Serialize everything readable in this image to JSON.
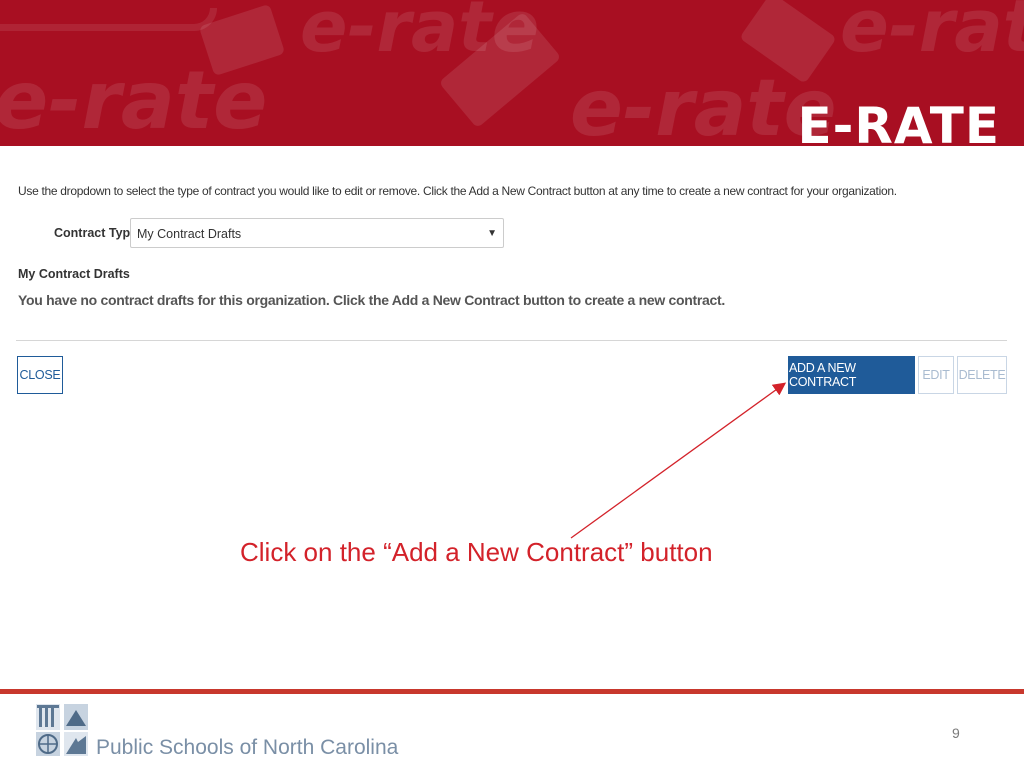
{
  "banner": {
    "brand": "E-RATE",
    "background_word": "e-rate",
    "color": "#a80f22"
  },
  "form": {
    "instructions": "Use the dropdown to select the type of contract you would like to edit or remove. Click the Add a New Contract button at any time to create a new contract for your organization.",
    "contract_type_label": "Contract Type",
    "contract_type_value": "My Contract Drafts",
    "drafts_heading": "My Contract Drafts",
    "drafts_message": "You have no contract drafts for this organization. Click the Add a New Contract button to create a new contract."
  },
  "buttons": {
    "close": "CLOSE",
    "add": "ADD A NEW CONTRACT",
    "edit": "EDIT",
    "delete": "DELETE"
  },
  "callout": {
    "text": "Click on the “Add a New Contract” button",
    "color": "#d3222a"
  },
  "footer": {
    "org": "Public Schools of North Carolina",
    "page_number": "9"
  },
  "colors": {
    "primary_button": "#1f5b99",
    "footer_rule": "#c8382d"
  }
}
